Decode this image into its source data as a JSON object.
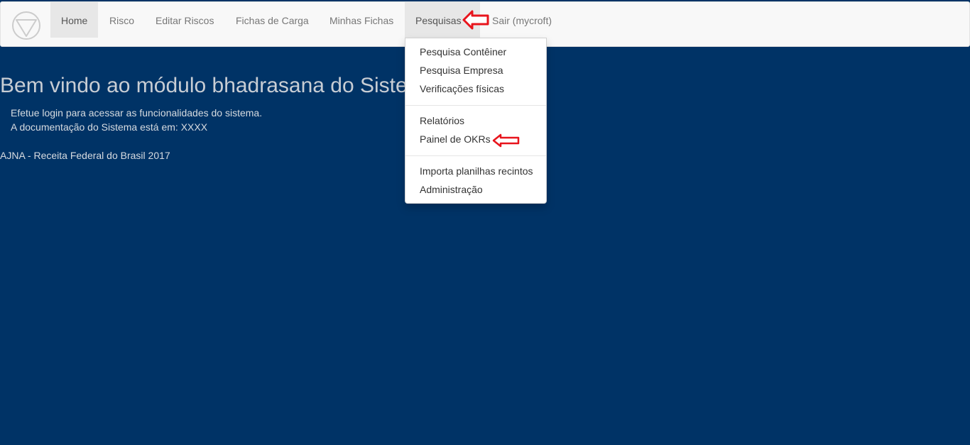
{
  "navbar": {
    "items": [
      {
        "label": "Home",
        "active": true
      },
      {
        "label": "Risco"
      },
      {
        "label": "Editar Riscos"
      },
      {
        "label": "Fichas de Carga"
      },
      {
        "label": "Minhas Fichas"
      },
      {
        "label": "Pesquisas",
        "open": true
      },
      {
        "label": "Sair (mycroft)"
      }
    ]
  },
  "dropdown": {
    "items": [
      "Pesquisa Contêiner",
      "Pesquisa Empresa",
      "Verificações físicas",
      "Relatórios",
      "Painel de OKRs",
      "Importa planilhas recintos",
      "Administração"
    ]
  },
  "main": {
    "welcome": "Bem vindo ao módulo bhadrasana do Sistema",
    "line1": "Efetue login para acessar as funcionalidades do sistema.",
    "line2": "A documentação do Sistema está em: XXXX",
    "footer": "AJNA - Receita Federal do Brasil 2017"
  },
  "colors": {
    "background": "#003366",
    "navbar": "#f8f8f8",
    "annotation_arrow": "#e8141c"
  }
}
